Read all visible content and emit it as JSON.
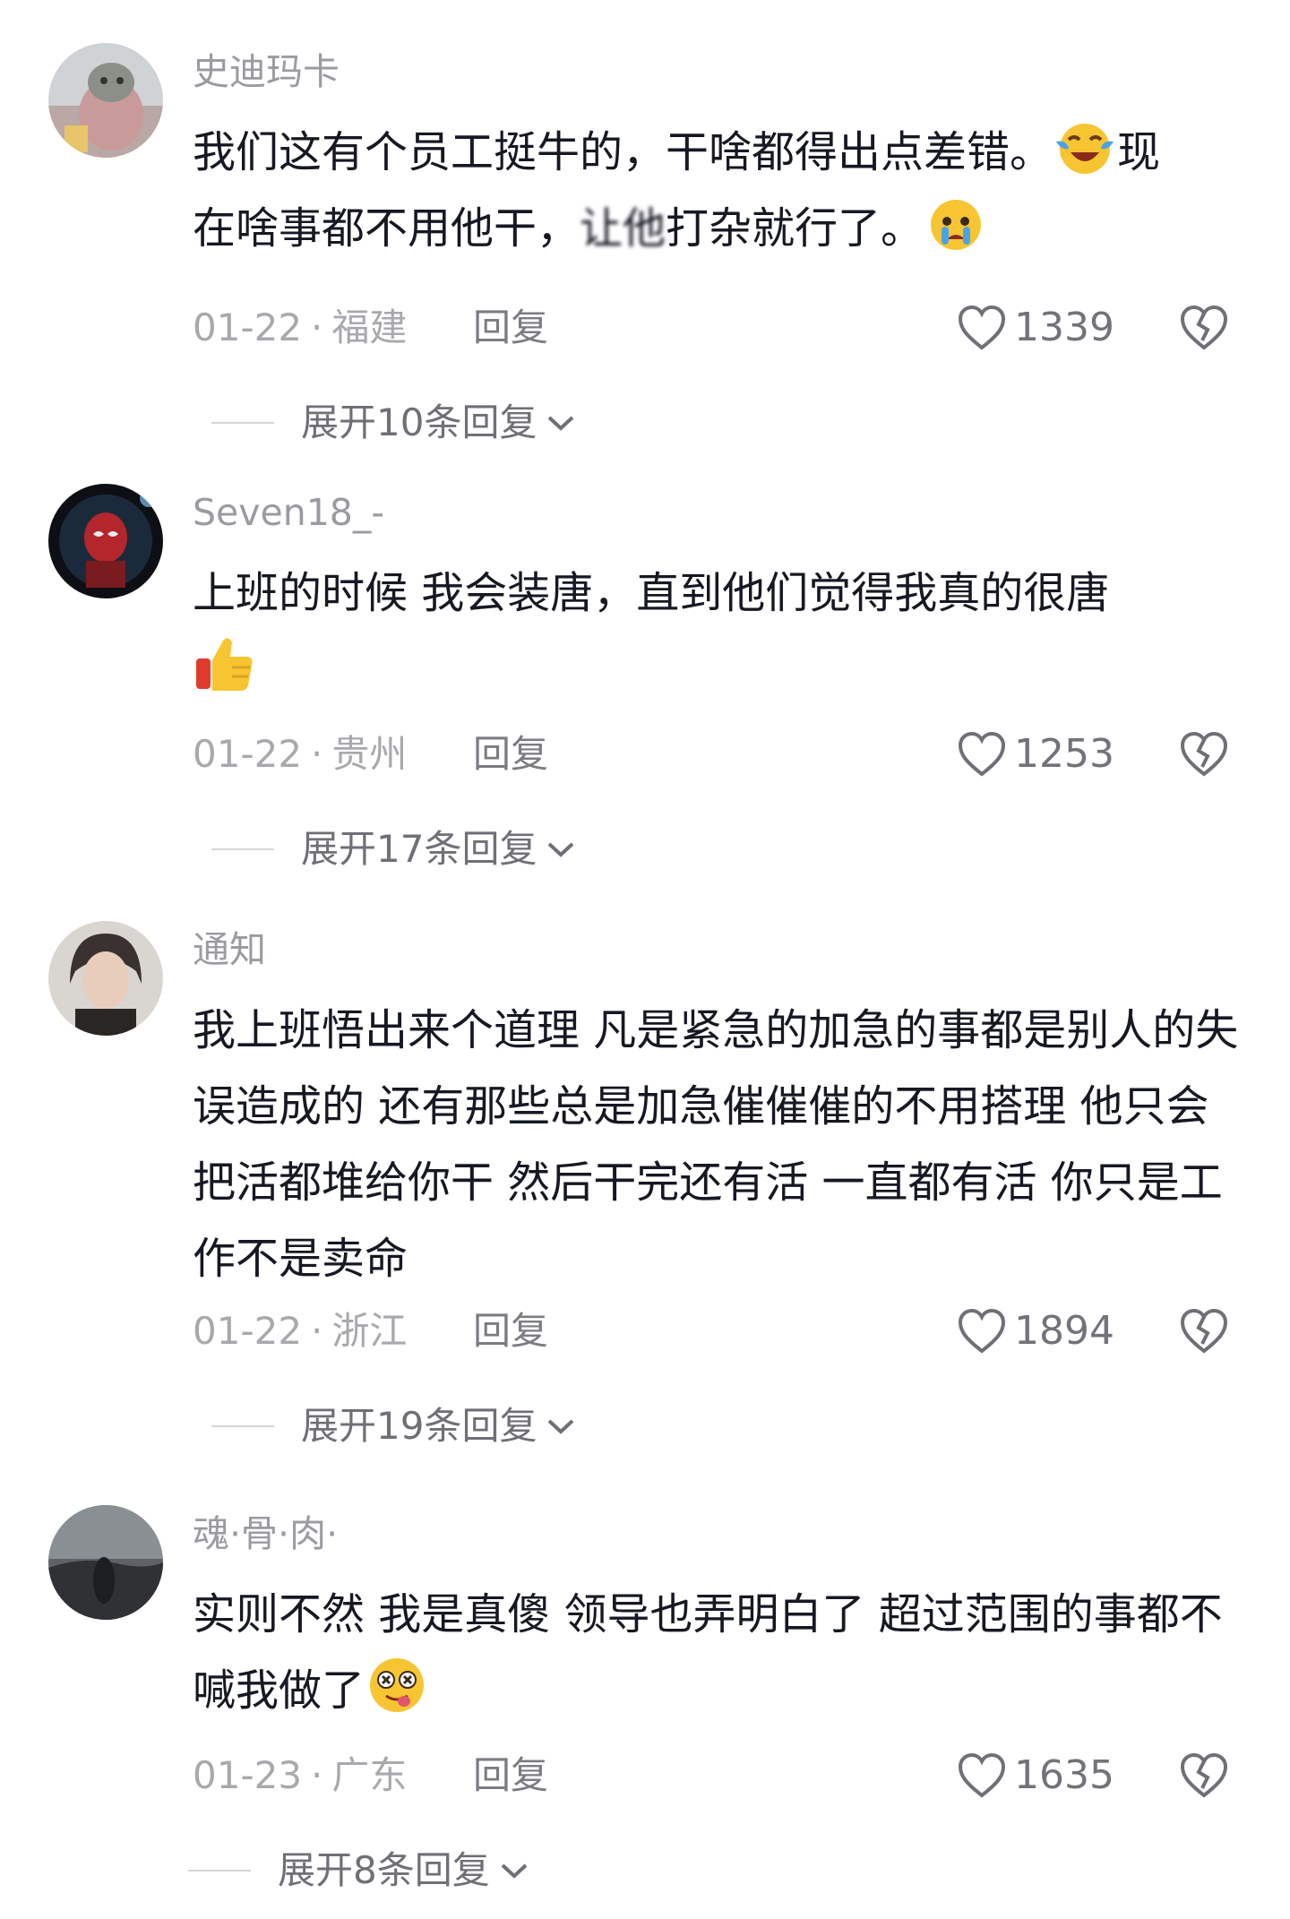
{
  "comments": [
    {
      "username": "史迪玛卡",
      "text_line1": "我们这有个员工挺牛的，干啥都得出点差错。",
      "emoji1": "crying-laughing-emoji",
      "text_line1_tail": "现",
      "text_line2": "在啥事都不用他干，",
      "text_line2_obscured": "让他",
      "text_line2_tail": "打杂就行了。",
      "emoji2": "crying-emoji",
      "date": "01-22",
      "location": "福建",
      "reply_label": "回复",
      "likes": "1339",
      "expand_label": "展开10条回复"
    },
    {
      "username": "Seven18_-",
      "text": "上班的时候  我会装唐，直到他们觉得我真的很唐",
      "emoji": "thumbs-up-emoji",
      "date": "01-22",
      "location": "贵州",
      "reply_label": "回复",
      "likes": "1253",
      "expand_label": "展开17条回复"
    },
    {
      "username": "通知",
      "text": "我上班悟出来个道理 凡是紧急的加急的事都是别人的失误造成的 还有那些总是加急催催催的不用搭理 他只会把活都堆给你干 然后干完还有活 一直都有活 你只是工作不是卖命",
      "date": "01-22",
      "location": "浙江",
      "reply_label": "回复",
      "likes": "1894",
      "expand_label": "展开19条回复"
    },
    {
      "username": "魂·骨·肉·",
      "text": "实则不然 我是真傻 领导也弄明白了 超过范围的事都不喊我做了",
      "emoji": "dizzy-face-emoji",
      "date": "01-23",
      "location": "广东",
      "reply_label": "回复",
      "likes": "1635",
      "expand_label": "展开8条回复"
    }
  ],
  "colors": {
    "text": "#161823",
    "muted": "#9a9ba1",
    "background": "#ffffff"
  }
}
